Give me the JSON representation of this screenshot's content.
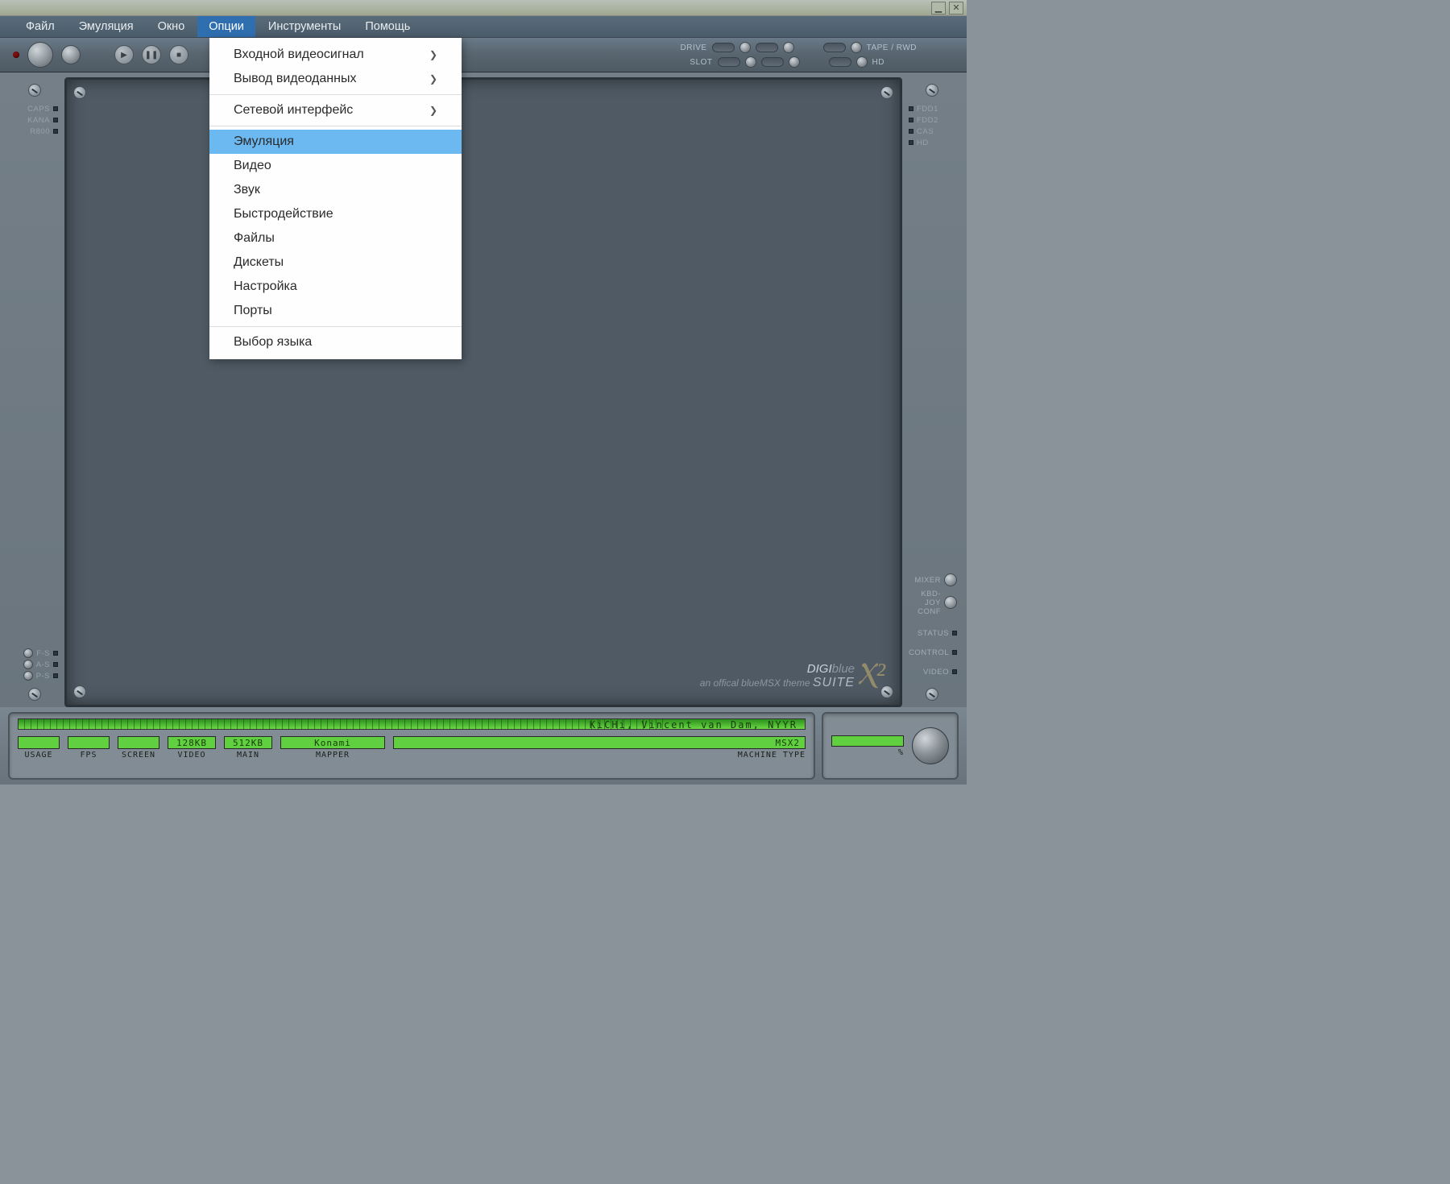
{
  "menubar": {
    "items": [
      {
        "label": "Файл"
      },
      {
        "label": "Эмуляция"
      },
      {
        "label": "Окно"
      },
      {
        "label": "Опции",
        "active": true
      },
      {
        "label": "Инструменты"
      },
      {
        "label": "Помощь"
      }
    ]
  },
  "dropdown": {
    "items": [
      {
        "label": "Входной видеосигнал",
        "submenu": true
      },
      {
        "label": "Вывод видеоданных",
        "submenu": true
      },
      {
        "sep": true
      },
      {
        "label": "Сетевой интерфейс",
        "submenu": true
      },
      {
        "sep": true
      },
      {
        "label": "Эмуляция",
        "selected": true
      },
      {
        "label": "Видео"
      },
      {
        "label": "Звук"
      },
      {
        "label": "Быстродействие"
      },
      {
        "label": "Файлы"
      },
      {
        "label": "Дискеты"
      },
      {
        "label": "Настройка"
      },
      {
        "label": "Порты"
      },
      {
        "sep": true
      },
      {
        "label": "Выбор языка"
      }
    ]
  },
  "toolbar": {
    "drive": "DRIVE",
    "slot": "SLOT",
    "tape": "TAPE / RWD",
    "hd": "HD"
  },
  "left_rail": {
    "caps": "CAPS",
    "kana": "KANA",
    "r800": "R800",
    "fs": "F-S",
    "as": "A-S",
    "ps": "P-S"
  },
  "right_rail": {
    "fdd1": "FDD1",
    "fdd2": "FDD2",
    "cas": "CAS",
    "hd": "HD",
    "mixer": "MIXER",
    "kbdjoy": "KBD-JOY CONF",
    "status": "STATUS",
    "control": "CONTROL",
    "video": "VIDEO"
  },
  "logo": {
    "line1a": "DIGI",
    "line1b": "blue",
    "line2": "an offical blueMSX theme",
    "suite": "SUITE"
  },
  "status": {
    "scroll": "KiCHi,  Vincent van Dam,  NYYR",
    "pct": "%",
    "usage": "USAGE",
    "fps": "FPS",
    "screen": "SCREEN",
    "video": "VIDEO",
    "video_val": "128KB",
    "main": "MAIN",
    "main_val": "512KB",
    "mapper": "MAPPER",
    "mapper_val": "Konami",
    "machine": "MACHINE TYPE",
    "machine_val": "MSX2"
  }
}
